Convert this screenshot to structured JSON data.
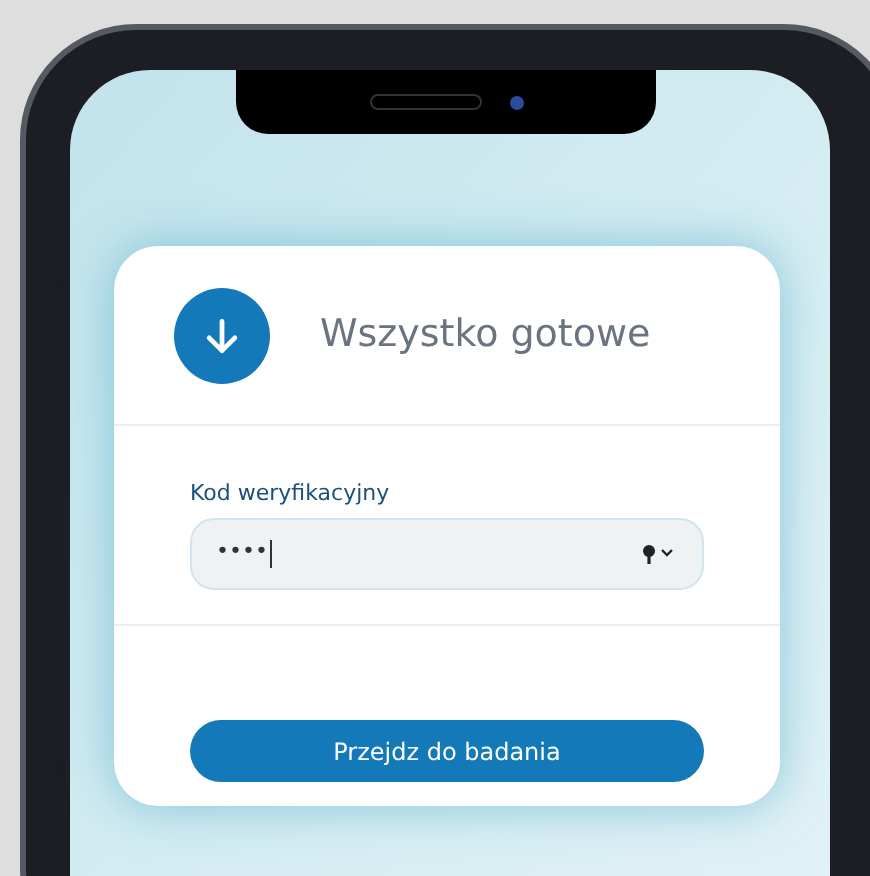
{
  "card": {
    "title": "Wszystko gotowe"
  },
  "field": {
    "label": "Kod weryfikacyjny",
    "value": "••••"
  },
  "button": {
    "label": "Przejdz do badania"
  }
}
